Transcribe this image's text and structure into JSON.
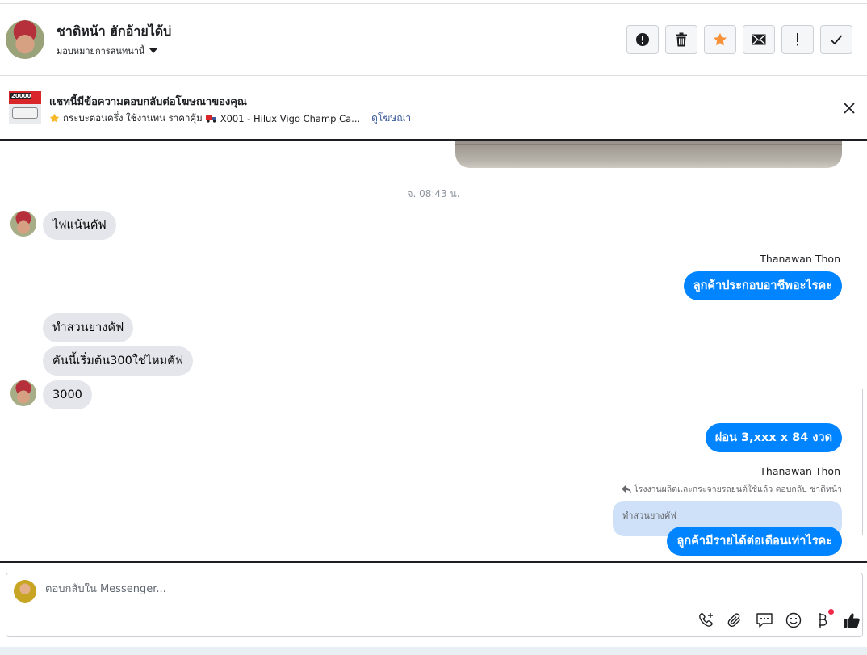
{
  "header": {
    "contact_name": "ชาติหน้า ฮักอ้ายได้บ่",
    "assign_label": "มอบหมายการสนทนานี้",
    "actions": [
      {
        "name": "mark-spam-button",
        "icon": "exclamation-circle-icon"
      },
      {
        "name": "delete-button",
        "icon": "trash-icon"
      },
      {
        "name": "star-button",
        "icon": "star-icon"
      },
      {
        "name": "mark-unread-button",
        "icon": "envelope-icon"
      },
      {
        "name": "follow-up-button",
        "icon": "exclamation-icon"
      },
      {
        "name": "mark-done-button",
        "icon": "check-icon"
      }
    ],
    "star_color": "#f7923b"
  },
  "ad_banner": {
    "thumb_text": "20000",
    "title": "แชทนี้มีข้อความตอบกลับต่อโฆษณาของคุณ",
    "description": "กระบะตอนครึ่ง ใช้งานทน ราคาคุ้ม",
    "product": "X001 - Hilux Vigo Champ Ca...",
    "link_label": "ดูโฆษณา"
  },
  "conversation": {
    "timestamp": "จ. 08:43 น.",
    "incoming_1": "ไฟแน้นคัฟ",
    "outgoing_1_sender": "Thanawan Thon",
    "outgoing_1": "ลูกค้าประกอบอาชีพอะไรคะ",
    "incoming_2a": "ทำสวนยางคัฟ",
    "incoming_2b": "คันนี้เริ่มต้น300ใช่ไหมคัฟ",
    "incoming_2c": "3000",
    "outgoing_2": "ผ่อน 3,xxx x 84 งวด",
    "outgoing_3_sender": "Thanawan Thon",
    "reply_context": "โรงงานผลิตและกระจายรถยนต์ใช้แล้ว ตอบกลับ ชาติหน้า",
    "quoted_text": "ทำสวนยางคัฟ",
    "outgoing_3": "ลูกค้ามีรายได้ต่อเดือนเท่าไรคะ"
  },
  "composer": {
    "placeholder": "ตอบกลับใน Messenger...",
    "tools": [
      "add-call-icon",
      "paperclip-icon",
      "saved-reply-icon",
      "emoji-icon",
      "baht-payment-icon",
      "thumbs-up-icon"
    ]
  },
  "colors": {
    "accent": "#0084ff",
    "incoming_bubble": "#e4e6eb",
    "quoted_bubble": "#cfe1f8",
    "link": "#385898",
    "notification_dot": "#f02849"
  }
}
